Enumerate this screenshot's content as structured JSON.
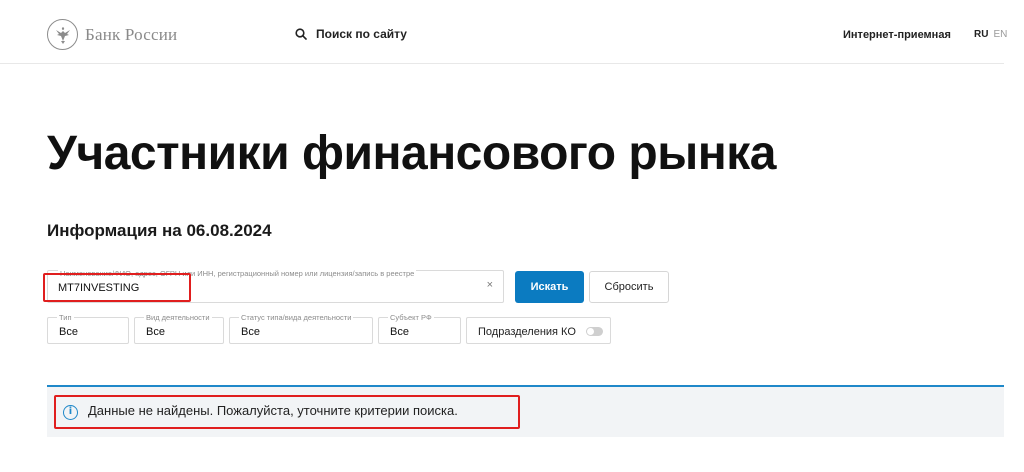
{
  "header": {
    "logo_text": "Банк России",
    "search_label": "Поиск по сайту",
    "reception_label": "Интернет-приемная",
    "lang_active": "RU",
    "lang_other": "EN"
  },
  "page": {
    "title": "Участники финансового рынка",
    "info_date": "Информация на 06.08.2024"
  },
  "search": {
    "placeholder_label": "Наименование/ФИО, адрес, ОГРН или ИНН, регистрационный номер или лицензия/запись в реестре",
    "value": "MT7INVESTING",
    "clear_symbol": "×",
    "submit_label": "Искать",
    "reset_label": "Сбросить"
  },
  "filters": [
    {
      "label": "Тип",
      "value": "Все"
    },
    {
      "label": "Вид деятельности",
      "value": "Все"
    },
    {
      "label": "Статус типа/вида деятельности",
      "value": "Все"
    },
    {
      "label": "Субъект РФ",
      "value": "Все"
    }
  ],
  "toggle": {
    "label": "Подразделения КО",
    "enabled": false
  },
  "result": {
    "icon": "info-icon",
    "icon_glyph": "i",
    "message": "Данные не найдены. Пожалуйста, уточните критерии поиска."
  },
  "colors": {
    "accent": "#0b7bc1",
    "annotation": "#e01e1e",
    "result_bg": "#f2f4f6"
  }
}
